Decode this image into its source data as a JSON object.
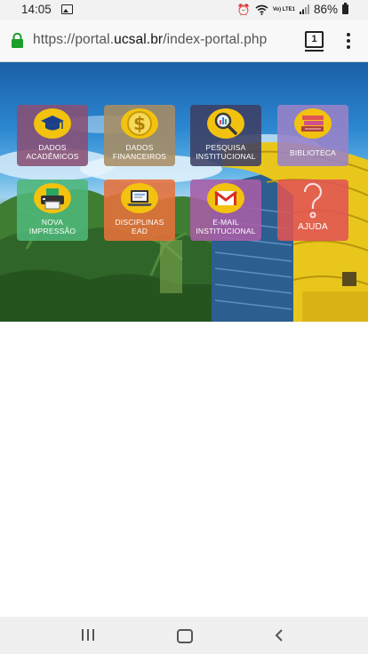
{
  "status_bar": {
    "time": "14:05",
    "network": "Vo) LTE1",
    "battery_percent": "86%"
  },
  "browser": {
    "url_prefix": "https://portal.",
    "url_domain": "ucsal.br",
    "url_path": "/index-portal.php",
    "tab_count": "1"
  },
  "portal": {
    "tiles": [
      {
        "line1": "DADOS",
        "line2": "ACADÊMICOS",
        "icon": "graduation-cap-icon",
        "color": "#8a4f74"
      },
      {
        "line1": "DADOS",
        "line2": "FINANCEIROS",
        "icon": "dollar-coin-icon",
        "color": "#a88c62"
      },
      {
        "line1": "PESQUISA",
        "line2": "INSTITUCIONAL",
        "icon": "magnifier-icon",
        "color": "#3e3f63"
      },
      {
        "line1": "BIBLIOTECA",
        "line2": "",
        "icon": "books-icon",
        "color": "#9a82c7"
      },
      {
        "line1": "NOVA",
        "line2": "IMPRESSÃO",
        "icon": "printer-icon",
        "color": "#4fb779"
      },
      {
        "line1": "DISCIPLINAS",
        "line2": "EAD",
        "icon": "laptop-icon",
        "color": "#e8713a"
      },
      {
        "line1": "E-MAIL",
        "line2": "INSTITUCIONAL",
        "icon": "gmail-icon",
        "color": "#a95da6"
      },
      {
        "line1": "AJUDA",
        "line2": "",
        "icon": "question-mark-icon",
        "color": "#e05454"
      }
    ]
  }
}
